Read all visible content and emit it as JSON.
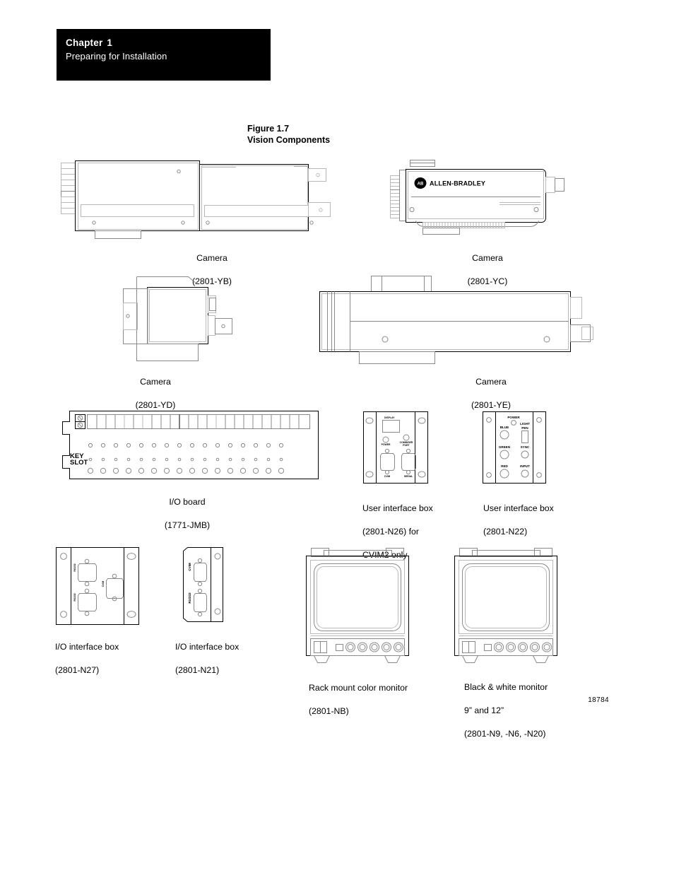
{
  "header": {
    "chapter_label": "Chapter",
    "chapter_number": "1",
    "chapter_title": "Preparing for Installation"
  },
  "figure": {
    "number": "Figure 1.7",
    "title": "Vision Components",
    "reference_number": "18784"
  },
  "components": [
    {
      "id": "camera-2801-yb",
      "caption_line1": "Camera",
      "caption_line2": "(2801-YB)"
    },
    {
      "id": "camera-2801-yc",
      "caption_line1": "Camera",
      "caption_line2": "(2801-YC)",
      "brand_label": "ALLEN-BRADLEY",
      "brand_mark": "AB"
    },
    {
      "id": "camera-2801-yd",
      "caption_line1": "Camera",
      "caption_line2": "(2801-YD)"
    },
    {
      "id": "camera-2801-ye",
      "caption_line1": "Camera",
      "caption_line2": "(2801-YE)"
    },
    {
      "id": "io-board-1771-jmb",
      "caption_line1": "I/O board",
      "caption_line2": "(1771-JMB)",
      "key_slot_label_line1": "KEY",
      "key_slot_label_line2": "SLOT"
    },
    {
      "id": "user-interface-box-2801-n26",
      "caption_line1": "User interface box",
      "caption_line2": "(2801-N26) for",
      "caption_line3": "CVIM2 only",
      "panel_labels": [
        "DISPLAY",
        "POWER",
        "COMM/SER",
        "PORT",
        "CVIM",
        "SERIAL"
      ]
    },
    {
      "id": "user-interface-box-2801-n22",
      "caption_line1": "User interface box",
      "caption_line2": "(2801-N22)",
      "panel_labels": [
        "POWER",
        "BLUE",
        "LIGHT",
        "PEN",
        "GREEN",
        "SYNC",
        "RED",
        "INPUT"
      ]
    },
    {
      "id": "io-interface-box-2801-n27",
      "caption_line1": "I/O interface box",
      "caption_line2": "(2801-N27)",
      "panel_labels": [
        "RS/232",
        "RS/232",
        "CVIM"
      ]
    },
    {
      "id": "io-interface-box-2801-n21",
      "caption_line1": "I/O interface box",
      "caption_line2": "(2801-N21)",
      "panel_labels": [
        "CVIM",
        "RS/232"
      ]
    },
    {
      "id": "rack-mount-color-monitor",
      "caption_line1": "Rack mount color monitor",
      "caption_line2": "(2801-NB)"
    },
    {
      "id": "black-white-monitor",
      "caption_line1": "Black & white monitor",
      "caption_line2": "9” and 12”",
      "caption_line3": "(2801-N9, -N6, -N20)"
    }
  ],
  "colors": {
    "header_background": "#000000",
    "header_text": "#ffffff",
    "line_dark": "#000000",
    "line_light": "#b9b9b9",
    "line_mid": "#8a8a8a",
    "page_background": "#ffffff"
  }
}
